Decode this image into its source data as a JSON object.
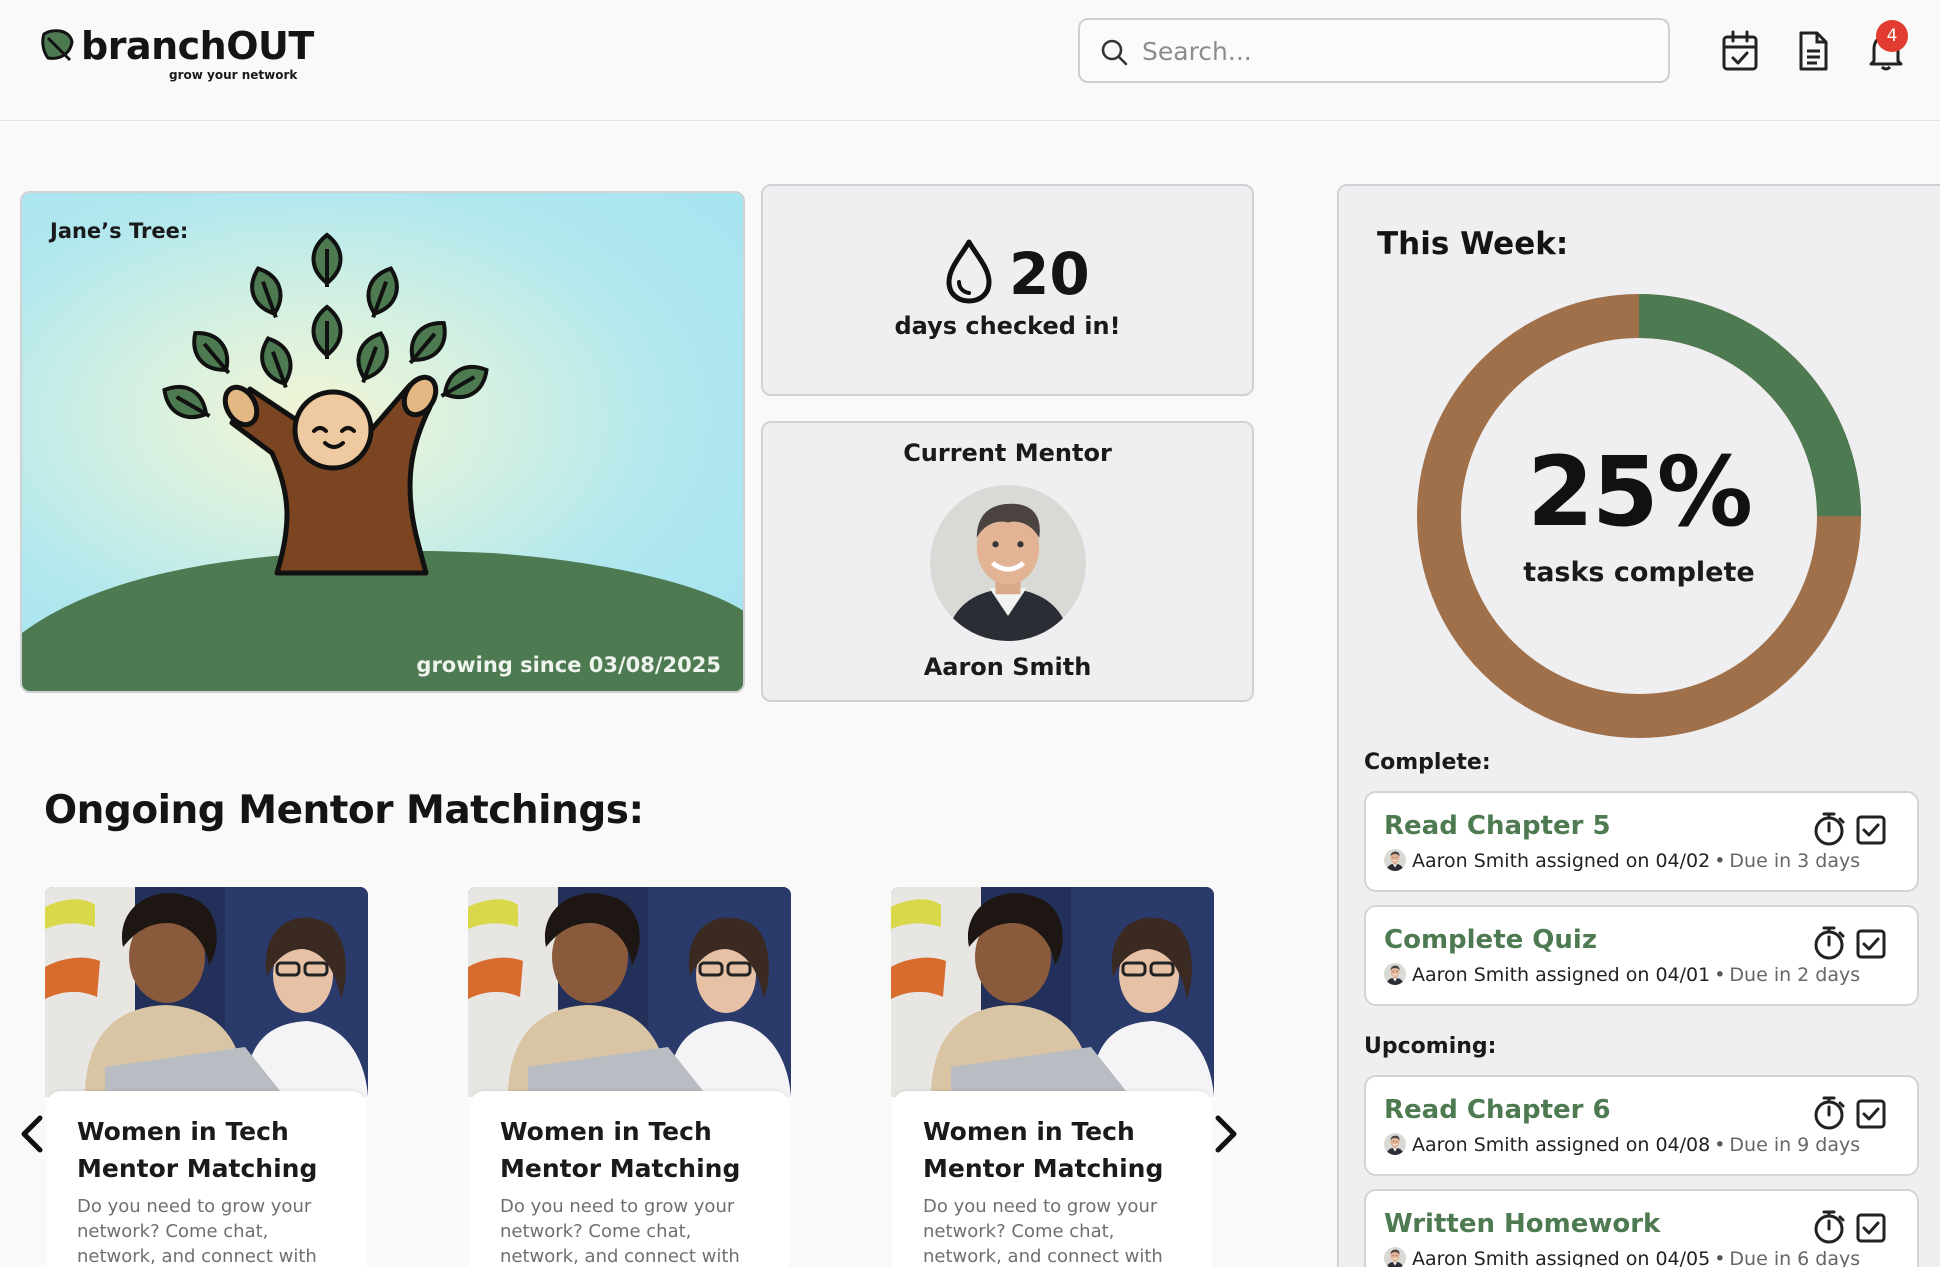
{
  "brand": {
    "name": "branchOUT",
    "tagline": "grow your network"
  },
  "search": {
    "placeholder": "Search..."
  },
  "header": {
    "notification_count": "4"
  },
  "tree": {
    "title": "Jane’s Tree:",
    "since": "growing since 03/08/2025"
  },
  "checkin": {
    "count": "20",
    "label": "days checked in!"
  },
  "mentor": {
    "title": "Current Mentor",
    "name": "Aaron Smith"
  },
  "ongoing": {
    "title": "Ongoing Mentor Matchings:",
    "cards": [
      {
        "title": "Women in Tech Mentor Matching",
        "description": "Do you need to grow your network? Come chat, network, and connect with a"
      },
      {
        "title": "Women in Tech Mentor Matching",
        "description": "Do you need to grow your network? Come chat, network, and connect with a"
      },
      {
        "title": "Women in Tech Mentor Matching",
        "description": "Do you need to grow your network? Come chat, network, and connect with a"
      }
    ]
  },
  "week": {
    "title": "This Week:",
    "progress_percent": 25,
    "percent_label": "25%",
    "progress_label": "tasks complete",
    "colors": {
      "done": "#4d7a50",
      "remaining": "#a0704a"
    },
    "complete_label": "Complete:",
    "upcoming_label": "Upcoming:",
    "complete": [
      {
        "title": "Read Chapter 5",
        "assigner": "Aaron Smith assigned on 04/02",
        "due": "Due in 3 days"
      },
      {
        "title": "Complete Quiz",
        "assigner": "Aaron Smith assigned on 04/01",
        "due": "Due in 2 days"
      }
    ],
    "upcoming": [
      {
        "title": "Read Chapter 6",
        "assigner": "Aaron Smith assigned on 04/08",
        "due": "Due in 9 days"
      },
      {
        "title": "Written Homework",
        "assigner": "Aaron Smith assigned on 04/05",
        "due": "Due in 6 days"
      }
    ]
  }
}
